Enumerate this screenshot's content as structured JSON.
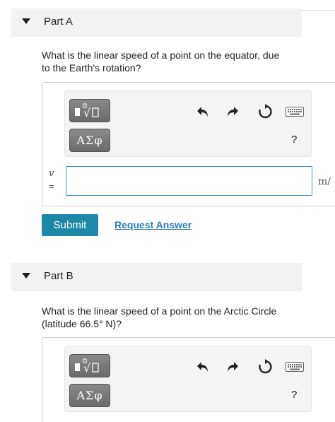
{
  "parts": [
    {
      "title": "Part A",
      "question_line1": "What is the linear speed of a point on the equator, due",
      "question_line2": "to the Earth's rotation?",
      "variable": "v",
      "equals": "=",
      "unit": "m/",
      "input_value": "",
      "greek_label": "ΑΣφ",
      "help_label": "?",
      "submit_label": "Submit",
      "request_label": "Request Answer"
    },
    {
      "title": "Part B",
      "question_line1": "What is the linear speed of a point on the Arctic Circle",
      "question_line2": "(latitude 66.5°  N)?",
      "greek_label": "ΑΣφ",
      "help_label": "?"
    }
  ],
  "icons": [
    "triangle-down-icon",
    "template-icon",
    "undo-icon",
    "redo-icon",
    "reset-icon",
    "keyboard-icon"
  ],
  "colors": {
    "header_bg": "#f2f2f2",
    "submit_bg": "#1e88a8",
    "link": "#2a7fb5",
    "input_border": "#3d8fd6",
    "toolbar_button": "#7a7a7a"
  }
}
